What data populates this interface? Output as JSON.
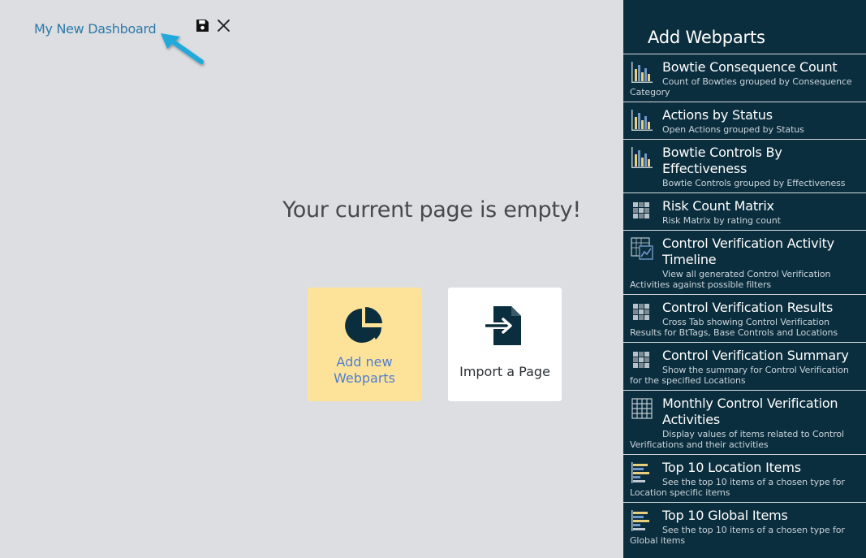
{
  "header": {
    "title": "My New Dashboard",
    "save_icon": "save-icon",
    "close_icon": "close-icon"
  },
  "main": {
    "empty_message": "Your current page is empty!",
    "add_tile": {
      "label": "Add new Webparts",
      "icon": "pie-chart-icon"
    },
    "import_tile": {
      "label": "Import a Page",
      "icon": "file-import-icon"
    }
  },
  "colors": {
    "sidebar_bg": "#0b2e3e",
    "page_bg": "#dddee2",
    "add_tile_bg": "#fde39a",
    "title_link": "#2c7aa8",
    "arrow": "#21a9db"
  },
  "sidebar": {
    "title": "Add Webparts",
    "items": [
      {
        "name": "Bowtie Consequence Count",
        "desc": "Count of Bowties grouped by Consequence Category",
        "icon": "bar-chart-icon"
      },
      {
        "name": "Actions by Status",
        "desc": "Open Actions grouped by Status",
        "icon": "bar-chart-icon"
      },
      {
        "name": "Bowtie Controls By Effectiveness",
        "desc": "Bowtie Controls grouped by Effectiveness",
        "icon": "bar-chart-icon"
      },
      {
        "name": "Risk Count Matrix",
        "desc": "Risk Matrix by rating count",
        "icon": "matrix-icon"
      },
      {
        "name": "Control Verification Activity Timeline",
        "desc": "View all generated Control Verification Activities against possible filters",
        "icon": "timeline-chart-icon"
      },
      {
        "name": "Control Verification Results",
        "desc": "Cross Tab showing Control Verification Results for BtTags, Base Controls and Locations",
        "icon": "matrix-icon"
      },
      {
        "name": "Control Verification Summary",
        "desc": "Show the summary for Control Verification for the specified Locations",
        "icon": "matrix-icon"
      },
      {
        "name": "Monthly Control Verification Activities",
        "desc": "Display values of items related to Control Verifications and their activities",
        "icon": "grid-table-icon"
      },
      {
        "name": "Top 10 Location Items",
        "desc": "See the top 10 items of a chosen type for Location specific items",
        "icon": "horizontal-bar-chart-icon"
      },
      {
        "name": "Top 10 Global Items",
        "desc": "See the top 10 items of a chosen type for Global items",
        "icon": "horizontal-bar-chart-icon"
      }
    ]
  }
}
